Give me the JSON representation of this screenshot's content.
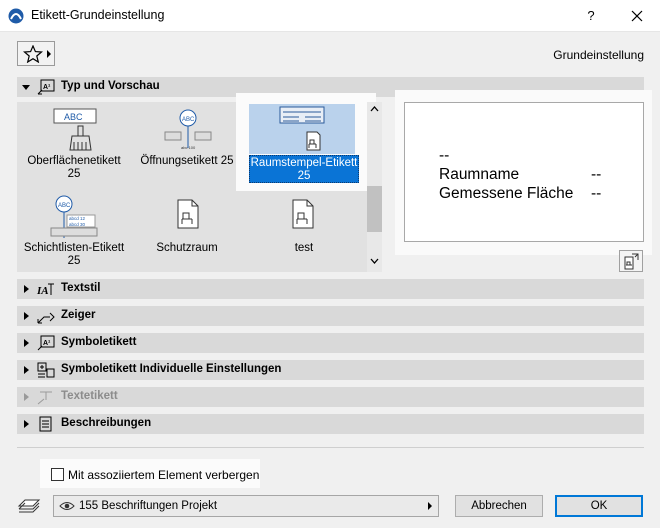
{
  "window": {
    "title": "Etikett-Grundeinstellung",
    "help_label": "?"
  },
  "header": {
    "preset_label": "Grundeinstellung"
  },
  "sections": {
    "typ": "Typ und Vorschau",
    "textstil": "Textstil",
    "zeiger": "Zeiger",
    "symboletikett": "Symboletikett",
    "symbol_individuell": "Symboletikett Individuelle Einstellungen",
    "textetikett": "Textetikett",
    "beschreibungen": "Beschreibungen"
  },
  "gallery": {
    "items": [
      {
        "label": "Oberflächenetikett",
        "sub": "25",
        "icon": "abc-brush-icon"
      },
      {
        "label": "Öffnungsetikett 25",
        "sub": "",
        "icon": "opening-tag-icon"
      },
      {
        "label": "Raumstempel-Etikett",
        "sub": "25",
        "icon": "room-stamp-icon",
        "selected": true
      },
      {
        "label": "Schichtlisten-Etikett",
        "sub": "25",
        "icon": "layer-list-tag-icon"
      },
      {
        "label": "Schutzraum",
        "sub": "",
        "icon": "document-chair-icon"
      },
      {
        "label": "test",
        "sub": "",
        "icon": "document-chair-icon"
      }
    ],
    "thumb_text": "ABC"
  },
  "preview": {
    "line1": "--",
    "line2_left": "Raumname",
    "line2_right": "--",
    "line3_left": "Gemessene Fläche",
    "line3_right": "--"
  },
  "footer": {
    "hide_checkbox_label": "Mit assoziiertem Element verbergen",
    "hide_checked": false,
    "layer_value": "155 Beschriftungen Projekt",
    "cancel_label": "Abbrechen",
    "ok_label": "OK"
  },
  "colors": {
    "selection": "#0a74d6",
    "selection_light": "#bad2ec",
    "ok_border": "#0078d7"
  }
}
